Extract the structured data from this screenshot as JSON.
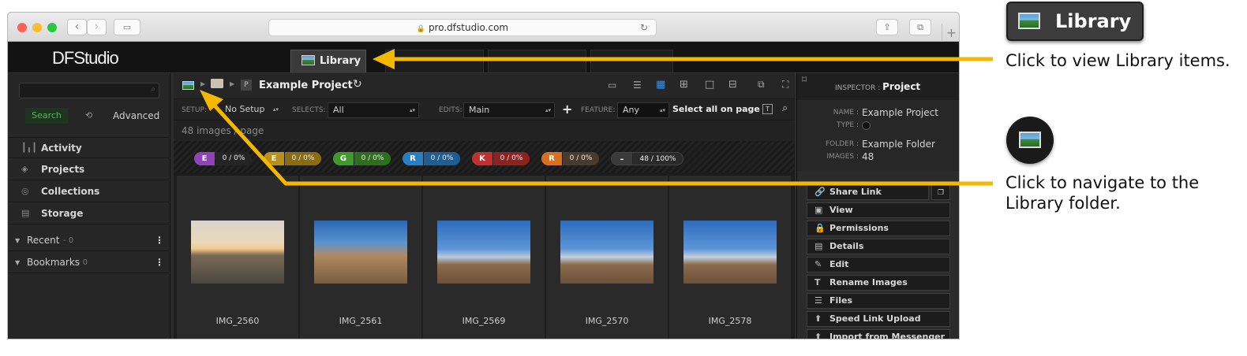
{
  "browser": {
    "url": "pro.dfstudio.com",
    "colors": {
      "close": "#ff5f57",
      "minimize": "#febc2e",
      "maximize": "#28c840"
    }
  },
  "app": {
    "logo": "DFStudio",
    "active_tab": "Library"
  },
  "sidebar": {
    "search_button": "Search",
    "advanced_label": "Advanced",
    "nav": [
      {
        "label": "Activity",
        "icon": "activity-icon"
      },
      {
        "label": "Projects",
        "icon": "projects-icon"
      },
      {
        "label": "Collections",
        "icon": "collections-icon"
      },
      {
        "label": "Storage",
        "icon": "storage-icon"
      }
    ],
    "collapsibles": [
      {
        "label": "Recent",
        "count": "- 0"
      },
      {
        "label": "Bookmarks",
        "count": "- 0"
      }
    ]
  },
  "main": {
    "breadcrumb": {
      "project_badge": "P",
      "title": "Example Project"
    },
    "filters": {
      "setup_label": "SETUP:",
      "setup_value": "No Setup",
      "selects_label": "SELECTS:",
      "selects_value": "All",
      "edits_label": "EDITS:",
      "edits_value": "Main",
      "add": "+",
      "feature_label": "FEATURE:",
      "feature_value": "Any",
      "select_all": "Select all on page",
      "text_toggle": "T"
    },
    "count_text": "48 images / page",
    "badges": [
      {
        "letter": "E",
        "value": "0 / 0%",
        "color": "#8f43b7"
      },
      {
        "letter": "E",
        "value": "0 / 0%",
        "color": "#b8901a"
      },
      {
        "letter": "G",
        "value": "0 / 0%",
        "color": "#3f9a2b"
      },
      {
        "letter": "R",
        "value": "0 / 0%",
        "color": "#2a7fc4"
      },
      {
        "letter": "K",
        "value": "0 / 0%",
        "color": "#c0302c"
      },
      {
        "letter": "R",
        "value": "0 / 0%",
        "color": "#d8701f"
      },
      {
        "letter": "–",
        "value": "48 / 100%",
        "color": "#3a3a3a"
      }
    ],
    "images": [
      {
        "name": "IMG_2560"
      },
      {
        "name": "IMG_2561"
      },
      {
        "name": "IMG_2569"
      },
      {
        "name": "IMG_2570"
      },
      {
        "name": "IMG_2578"
      }
    ]
  },
  "inspector": {
    "title_prefix": "INSPECTOR :",
    "title": "Project",
    "fields": [
      {
        "key": "NAME :",
        "value": "Example Project"
      },
      {
        "key": "TYPE :",
        "value": ""
      },
      {
        "key": "FOLDER :",
        "value": "Example Folder"
      },
      {
        "key": "IMAGES :",
        "value": "48"
      }
    ],
    "actions": [
      {
        "label": "Share Link",
        "icon": "link-icon"
      },
      {
        "label": "View",
        "icon": "view-icon"
      },
      {
        "label": "Permissions",
        "icon": "lock-icon"
      },
      {
        "label": "Details",
        "icon": "details-icon"
      },
      {
        "label": "Edit",
        "icon": "pencil-icon"
      },
      {
        "label": "Rename Images",
        "icon": "rename-icon"
      },
      {
        "label": "Files",
        "icon": "files-icon"
      },
      {
        "label": "Speed Link Upload",
        "icon": "upload-icon"
      },
      {
        "label": "Import from Messenger",
        "icon": "upload-icon"
      }
    ]
  },
  "annotations": {
    "tab_callout_label": "Library",
    "tab_text": "Click to view Library items.",
    "icon_text": "Click to navigate to the Library folder.",
    "arrow_color": "#f5b800"
  }
}
